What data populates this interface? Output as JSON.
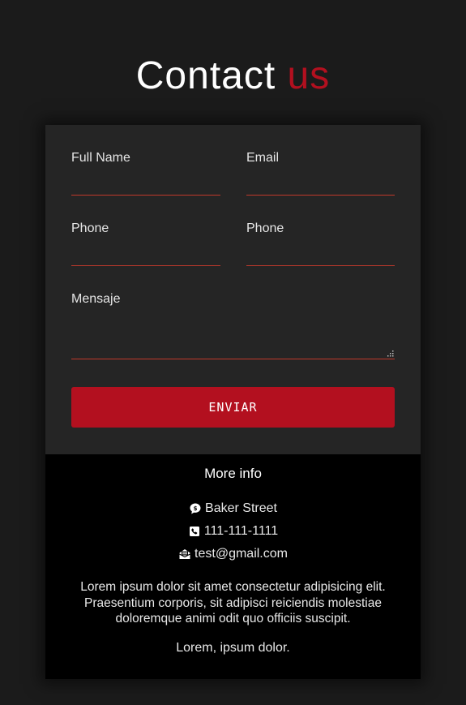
{
  "heading": {
    "main": "Contact",
    "accent": "us"
  },
  "form": {
    "full_name_label": "Full Name",
    "email_label": "Email",
    "phone_label_1": "Phone",
    "phone_label_2": "Phone",
    "message_label": "Mensaje",
    "submit_label": "ENVIAR"
  },
  "info": {
    "title": "More info",
    "address": "Baker Street",
    "phone": "111-111-1111",
    "email": "test@gmail.com",
    "paragraph": "Lorem ipsum dolor sit amet consectetur adipisicing elit. Praesentium corporis, sit adipisci reiciendis molestiae doloremque animi odit quo officiis suscipit.",
    "footer_text": "Lorem, ipsum dolor."
  },
  "colors": {
    "accent": "#b3101f",
    "underline": "#c0392b",
    "page_bg": "#1b1b1b",
    "form_bg": "#252525",
    "info_bg": "#000000"
  },
  "icons": {
    "address": "map-marker-bubble-icon",
    "phone": "phone-square-icon",
    "email": "envelope-open-icon",
    "resize": "resize-grip-icon"
  }
}
